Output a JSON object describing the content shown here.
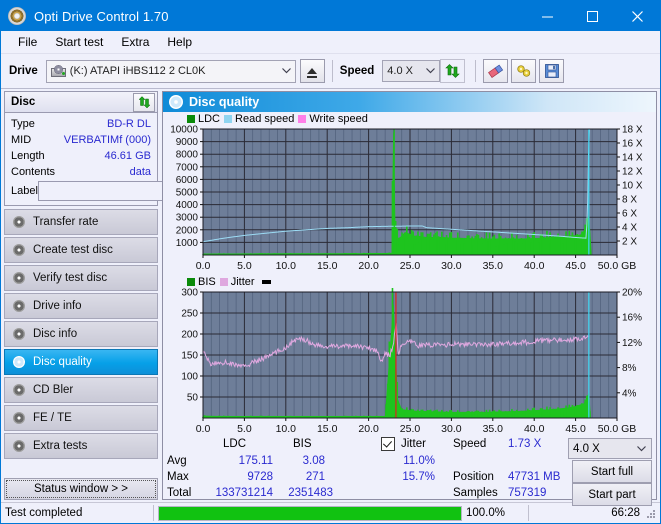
{
  "window": {
    "title": "Opti Drive Control 1.70",
    "icon": "disc-icon",
    "minimize": "–",
    "maximize": "☐",
    "close": "✕"
  },
  "menu": {
    "items": [
      {
        "label": "File",
        "accel": "F"
      },
      {
        "label": "Start test",
        "accel": "S"
      },
      {
        "label": "Extra",
        "accel": "x"
      },
      {
        "label": "Help",
        "accel": "H"
      }
    ]
  },
  "toolbar": {
    "drive_label": "Drive",
    "drive_value": "(K:)  ATAPI iHBS112  2 CL0K",
    "eject_icon": "eject-icon",
    "speed_label": "Speed",
    "speed_value": "4.0 X",
    "refresh_icon": "refresh-icon",
    "erase_icon": "eraser-icon",
    "tools_icon": "tools-icon",
    "save_icon": "save-icon"
  },
  "sidebar": {
    "disc_panel": {
      "title": "Disc",
      "refresh_icon": "refresh-icon",
      "rows": [
        {
          "key": "Type",
          "value": "BD-R DL"
        },
        {
          "key": "MID",
          "value": "VERBATIMf (000)"
        },
        {
          "key": "Length",
          "value": "46.61 GB"
        },
        {
          "key": "Contents",
          "value": "data"
        }
      ],
      "label_key": "Label",
      "label_value": "",
      "label_placeholder": "",
      "disc_button_icon": "cd-icon"
    },
    "nav": [
      {
        "label": "Transfer rate",
        "icon": "disc-icon",
        "active": false
      },
      {
        "label": "Create test disc",
        "icon": "disc-icon",
        "active": false
      },
      {
        "label": "Verify test disc",
        "icon": "disc-icon",
        "active": false
      },
      {
        "label": "Drive info",
        "icon": "disc-icon",
        "active": false
      },
      {
        "label": "Disc info",
        "icon": "disc-icon",
        "active": false
      },
      {
        "label": "Disc quality",
        "icon": "disc-icon",
        "active": true
      },
      {
        "label": "CD Bler",
        "icon": "disc-icon",
        "active": false
      },
      {
        "label": "FE / TE",
        "icon": "disc-icon",
        "active": false
      },
      {
        "label": "Extra tests",
        "icon": "disc-icon",
        "active": false
      }
    ],
    "status_window_button": "Status window > >"
  },
  "main": {
    "header_title": "Disc quality",
    "header_icon": "disc-icon"
  },
  "stats": {
    "col_ldc": "LDC",
    "col_bis": "BIS",
    "jitter_label": "Jitter",
    "jitter_checked": true,
    "rows": [
      {
        "name": "Avg",
        "ldc": "175.11",
        "bis": "3.08",
        "jitter": "11.0%"
      },
      {
        "name": "Max",
        "ldc": "9728",
        "bis": "271",
        "jitter": "15.7%"
      },
      {
        "name": "Total",
        "ldc": "133731214",
        "bis": "2351483",
        "jitter": ""
      }
    ],
    "speed_key": "Speed",
    "speed_value": "1.73 X",
    "position_key": "Position",
    "position_value": "47731 MB",
    "samples_key": "Samples",
    "samples_value": "757319",
    "speed_select": "4.0 X",
    "start_full": "Start full",
    "start_part": "Start part"
  },
  "statusbar": {
    "text": "Test completed",
    "progress_percent": "100.0%",
    "progress_value": 100,
    "elapsed": "66:28"
  },
  "chart_data": [
    {
      "type": "area",
      "name": "ldc-chart",
      "title": "",
      "xlabel": "GB",
      "ylabel": "",
      "xlim": [
        0.0,
        50.0
      ],
      "ylim": [
        0,
        10000
      ],
      "y2lim": [
        0,
        18
      ],
      "y2label": "X",
      "grid": true,
      "legend_position": "top-left",
      "legend": [
        {
          "label": "LDC",
          "color": "#0aa00a"
        },
        {
          "label": "Read speed",
          "color": "#8fd8f5"
        },
        {
          "label": "Write speed",
          "color": "#ff7fe0"
        }
      ],
      "yticks": [
        10000,
        9000,
        8000,
        7000,
        6000,
        5000,
        4000,
        3000,
        2000,
        1000
      ],
      "y2ticks": [
        18,
        16,
        14,
        12,
        10,
        8,
        6,
        4,
        2
      ],
      "xticks": [
        "0.0",
        "5.0",
        "10.0",
        "15.0",
        "20.0",
        "25.0",
        "30.0",
        "35.0",
        "40.0",
        "45.0",
        "50.0"
      ],
      "series": [
        {
          "name": "LDC",
          "color": "#1ec41e",
          "kind": "area",
          "axis": "left",
          "x": [
            0.0,
            1.0,
            2.0,
            3.0,
            4.0,
            5.0,
            6.0,
            7.0,
            8.0,
            9.0,
            10.0,
            11.0,
            12.0,
            13.0,
            14.0,
            15.0,
            16.0,
            17.0,
            18.0,
            19.0,
            20.0,
            21.0,
            22.0,
            22.8,
            23.0,
            23.2,
            23.4,
            23.6,
            24.0,
            24.4,
            24.8,
            25.2,
            25.6,
            26.0,
            26.4,
            27.0,
            28.0,
            29.0,
            30.0,
            31.0,
            32.0,
            33.0,
            34.0,
            35.0,
            36.0,
            37.0,
            38.0,
            39.0,
            40.0,
            41.0,
            42.0,
            43.0,
            44.0,
            45.0,
            45.6,
            46.0,
            46.3,
            46.6,
            46.8,
            46.9
          ],
          "y": [
            90,
            95,
            100,
            95,
            100,
            105,
            100,
            110,
            105,
            115,
            110,
            120,
            115,
            120,
            110,
            115,
            120,
            115,
            125,
            120,
            130,
            125,
            135,
            150,
            9728,
            2600,
            1600,
            1300,
            1500,
            1800,
            1700,
            1600,
            1500,
            1500,
            1450,
            1400,
            1400,
            1400,
            1350,
            1350,
            1320,
            1300,
            1300,
            1280,
            1300,
            1300,
            1280,
            1300,
            1320,
            1350,
            1400,
            1450,
            1500,
            1550,
            1600,
            1900,
            2400,
            3200,
            1200,
            120
          ]
        },
        {
          "name": "Read speed",
          "color": "#9cdcf5",
          "kind": "line",
          "axis": "right",
          "x": [
            0.0,
            2.5,
            5.0,
            7.5,
            10.0,
            12.5,
            15.0,
            17.5,
            20.0,
            22.5,
            23.5,
            25.0,
            26.5,
            27.0,
            29.0,
            31.0,
            33.0,
            35.0,
            37.0,
            39.0,
            41.0,
            43.0,
            45.0,
            46.3,
            46.5,
            46.6,
            46.7
          ],
          "y": [
            1.9,
            2.4,
            2.8,
            3.1,
            3.4,
            3.6,
            3.8,
            3.9,
            4.05,
            4.1,
            4.1,
            4.15,
            4.15,
            3.9,
            3.75,
            3.6,
            3.45,
            3.3,
            3.15,
            3.0,
            2.85,
            2.7,
            2.5,
            2.4,
            9.0,
            18.0,
            18.0
          ]
        }
      ],
      "markers": [
        {
          "type": "vline",
          "x": 23.1,
          "color": "#1ec41e"
        },
        {
          "type": "vline",
          "x": 46.6,
          "color": "#3fd9f5"
        }
      ]
    },
    {
      "type": "line",
      "name": "bis-jitter-chart",
      "title": "",
      "xlabel": "GB",
      "ylabel": "",
      "xlim": [
        0.0,
        50.0
      ],
      "ylim": [
        0,
        300
      ],
      "y2lim": [
        0,
        20
      ],
      "y2label": "%",
      "grid": true,
      "legend_position": "top-left",
      "legend": [
        {
          "label": "BIS",
          "color": "#0aa00a"
        },
        {
          "label": "Jitter",
          "color": "#e2a8e2"
        }
      ],
      "yticks": [
        300,
        250,
        200,
        150,
        100,
        50
      ],
      "y2ticks": [
        "20%",
        "16%",
        "12%",
        "8%",
        "4%"
      ],
      "xticks": [
        "0.0",
        "5.0",
        "10.0",
        "15.0",
        "20.0",
        "25.0",
        "30.0",
        "35.0",
        "40.0",
        "45.0",
        "50.0"
      ],
      "series": [
        {
          "name": "BIS",
          "color": "#1ec41e",
          "kind": "area",
          "axis": "left",
          "x": [
            0.0,
            2.0,
            4.0,
            6.0,
            8.0,
            10.0,
            12.0,
            14.0,
            16.0,
            18.0,
            20.0,
            22.0,
            23.0,
            23.5,
            24.0,
            25.0,
            26.0,
            27.0,
            28.0,
            30.0,
            32.0,
            34.0,
            36.0,
            38.0,
            40.0,
            42.0,
            44.0,
            45.0,
            46.0,
            46.4,
            46.6,
            46.8
          ],
          "y": [
            5,
            4,
            4,
            4,
            4,
            4,
            4,
            4,
            4,
            4,
            4,
            4,
            270,
            45,
            20,
            18,
            16,
            16,
            15,
            14,
            14,
            14,
            15,
            16,
            18,
            20,
            24,
            28,
            34,
            48,
            60,
            6
          ]
        },
        {
          "name": "Jitter",
          "color": "#e0a8e0",
          "kind": "line",
          "axis": "left",
          "x": [
            0.0,
            0.5,
            1.0,
            2.0,
            3.0,
            4.0,
            5.0,
            6.0,
            7.0,
            8.0,
            9.0,
            10.0,
            11.0,
            12.0,
            12.5,
            13.0,
            14.0,
            15.0,
            16.0,
            17.0,
            18.0,
            19.0,
            20.0,
            21.0,
            21.6,
            22.0,
            22.6,
            23.0,
            23.3,
            23.6,
            24.0,
            25.0,
            25.6,
            26.0,
            27.0,
            29.0,
            31.0,
            33.0,
            35.0,
            37.0,
            39.0,
            41.0,
            43.0,
            45.0,
            46.0,
            46.4,
            46.6
          ],
          "y": [
            160,
            140,
            128,
            132,
            132,
            126,
            122,
            132,
            140,
            148,
            158,
            168,
            184,
            188,
            186,
            178,
            172,
            168,
            172,
            170,
            172,
            170,
            168,
            160,
            136,
            152,
            150,
            178,
            230,
            150,
            176,
            180,
            178,
            172,
            174,
            174,
            176,
            174,
            176,
            178,
            180,
            184,
            186,
            188,
            192,
            196,
            198
          ]
        }
      ],
      "markers": [
        {
          "type": "vline",
          "x": 23.3,
          "color": "#e02020"
        },
        {
          "type": "vline",
          "x": 46.6,
          "color": "#3fd9f5"
        }
      ]
    }
  ]
}
